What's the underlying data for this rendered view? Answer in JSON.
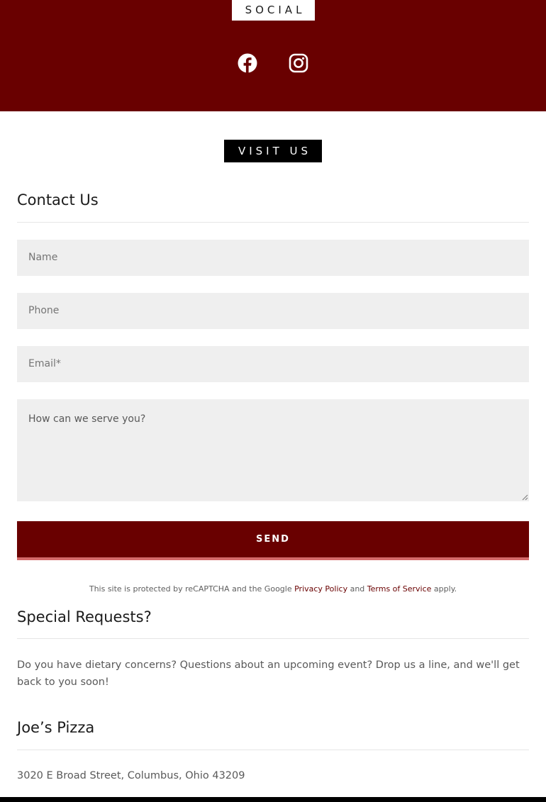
{
  "social": {
    "label": "SOCIAL",
    "icons": [
      "facebook-icon",
      "instagram-icon"
    ]
  },
  "visit": {
    "label": "VISIT US"
  },
  "contact": {
    "title": "Contact Us",
    "fields": {
      "name_placeholder": "Name",
      "phone_placeholder": "Phone",
      "email_placeholder": "Email*",
      "message_placeholder": "How can we serve you?"
    },
    "send_label": "SEND",
    "recaptcha": {
      "prefix": "This site is protected by reCAPTCHA and the Google ",
      "privacy_link": "Privacy Policy",
      "middle": " and ",
      "terms_link": "Terms of Service",
      "suffix": " apply."
    }
  },
  "special_requests": {
    "title": "Special Requests?",
    "text": "Do you have dietary concerns? Questions about an upcoming event? Drop us a line, and we'll get back to you soon!"
  },
  "business": {
    "name": "Joe’s Pizza",
    "address": "3020 E Broad Street, Columbus, Ohio 43209"
  },
  "colors": {
    "brand": "#690000",
    "button_accent": "#d46a6a",
    "field_bg": "#efefef"
  }
}
